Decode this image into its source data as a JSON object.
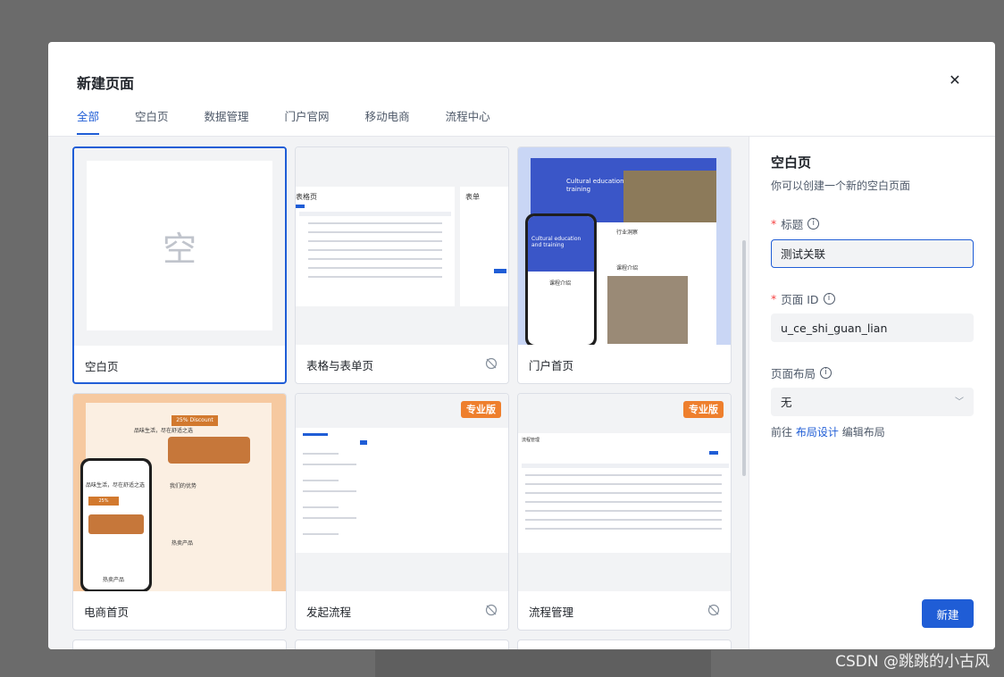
{
  "modal": {
    "title": "新建页面",
    "close_icon": "close-icon",
    "tabs": [
      "全部",
      "空白页",
      "数据管理",
      "门户官网",
      "移动电商",
      "流程中心"
    ],
    "active_tab": "全部"
  },
  "cards": [
    {
      "label": "空白页",
      "thumb_char": "空",
      "selected": true
    },
    {
      "label": "表格与表单页",
      "thumb_header_left": "表格页",
      "thumb_header_right": "表单",
      "hidden_icon": "eye-off-icon"
    },
    {
      "label": "门户首页",
      "thumb_hero": "Cultural education and training",
      "thumb_phone_hero": "Cultural education and training",
      "thumb_section1": "行业洞察",
      "thumb_section2": "课程介绍",
      "thumb_section3": "课程介绍"
    },
    {
      "label": "电商首页",
      "thumb_headline": "品味生活，尽在舒适之选",
      "thumb_discount": "25% Discount",
      "thumb_phone_headline": "品味生活，尽在舒适之选",
      "thumb_phone_discount": "25% Discount",
      "thumb_section": "我们的优势",
      "thumb_products": "热卖产品",
      "thumb_products2": "热卖产品"
    },
    {
      "label": "发起流程",
      "badge": "专业版",
      "hidden_icon": "eye-off-icon"
    },
    {
      "label": "流程管理",
      "badge": "专业版",
      "thumb_title": "流程管理",
      "hidden_icon": "eye-off-icon"
    }
  ],
  "panel": {
    "title": "空白页",
    "desc": "你可以创建一个新的空白页面",
    "title_label": "标题",
    "title_value": "测试关联",
    "id_label": "页面 ID",
    "id_value": "u_ce_shi_guan_lian",
    "layout_label": "页面布局",
    "layout_value": "无",
    "layout_prefix": "前往",
    "layout_link": "布局设计",
    "layout_suffix": "编辑布局",
    "submit": "新建"
  },
  "watermark": "CSDN @跳跳的小古风",
  "colors": {
    "primary": "#1f5dd6",
    "badge": "#ee7f2d",
    "required": "#f53f3f"
  }
}
